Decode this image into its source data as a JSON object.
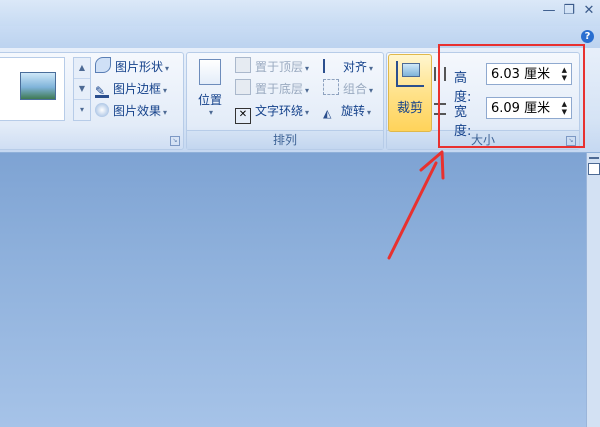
{
  "window": {
    "minimize_glyph": "—",
    "restore_glyph": "❐",
    "close_glyph": "✕"
  },
  "help_glyph": "?",
  "picture_styles": {
    "shape_label": "图片形状",
    "border_label": "图片边框",
    "effects_label": "图片效果"
  },
  "arrange": {
    "group_label": "排列",
    "position_label": "位置",
    "bring_front_label": "置于顶层",
    "send_back_label": "置于底层",
    "wrap_text_label": "文字环绕",
    "align_label": "对齐",
    "group_obj_label": "组合",
    "rotate_label": "旋转"
  },
  "size": {
    "group_label": "大小",
    "crop_label": "裁剪",
    "height_label": "高度:",
    "height_value": "6.03 厘米",
    "width_label": "宽度:",
    "width_value": "6.09 厘米"
  },
  "colors": {
    "annotation_red": "#e8312f",
    "accent_blue": "#15428b"
  }
}
